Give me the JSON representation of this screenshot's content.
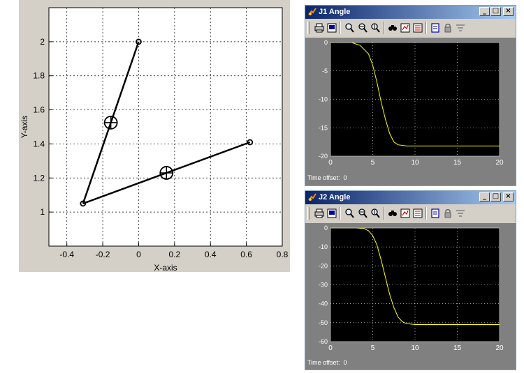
{
  "figure": {
    "xlabel": "X-axis",
    "ylabel": "Y-axis",
    "xticks": [
      "-0.4",
      "-0.2",
      "0",
      "0.2",
      "0.4",
      "0.6",
      "0.8"
    ],
    "yticks": [
      "1",
      "1.2",
      "1.4",
      "1.6",
      "1.8",
      "2"
    ],
    "grid": true,
    "links": [
      {
        "from": [
          0.0,
          2.0
        ],
        "to": [
          -0.31,
          1.05
        ],
        "com": [
          -0.155,
          1.525
        ]
      },
      {
        "from": [
          -0.31,
          1.05
        ],
        "to": [
          0.62,
          1.41
        ],
        "com": [
          0.155,
          1.23
        ]
      }
    ]
  },
  "scope1": {
    "title": "J1 Angle",
    "yticks": [
      "0",
      "-5",
      "-10",
      "-15",
      "-20"
    ],
    "xticks": [
      "0",
      "5",
      "10",
      "15",
      "20"
    ],
    "time_offset_label": "Time offset:",
    "time_offset_value": "0"
  },
  "scope2": {
    "title": "J2 Angle",
    "yticks": [
      "0",
      "-10",
      "-20",
      "-30",
      "-40",
      "-50",
      "-60"
    ],
    "xticks": [
      "0",
      "5",
      "10",
      "15",
      "20"
    ],
    "time_offset_label": "Time offset:",
    "time_offset_value": "0"
  },
  "window_buttons": {
    "minimize": "_",
    "maximize": "□",
    "close": "×"
  },
  "colors": {
    "titlebar_start": "#0a246a",
    "titlebar_end": "#a6caf0",
    "trace": "#ffff00",
    "scope_bg": "#000000"
  },
  "toolbar_icons": [
    "print-icon",
    "print-figure-icon",
    "zoom-icon",
    "zoom-x-icon",
    "zoom-y-icon",
    "autoscale-icon",
    "save-axes-icon",
    "restore-axes-icon",
    "parameters-icon",
    "lock-icon",
    "signal-selection-icon"
  ],
  "chart_data": [
    {
      "type": "line",
      "title": "J1 Angle",
      "xlim": [
        0,
        20
      ],
      "ylim": [
        -20,
        0
      ],
      "series": [
        {
          "x": [
            0,
            2.5,
            3.5,
            4.5,
            5.0,
            5.5,
            6.0,
            6.5,
            7.0,
            7.5,
            8.0,
            9.0,
            10,
            15,
            20
          ],
          "values": [
            0,
            0,
            -0.5,
            -2,
            -4,
            -7,
            -10.5,
            -13.5,
            -16,
            -17.5,
            -18,
            -18.2,
            -18.2,
            -18.2,
            -18.2
          ]
        }
      ]
    },
    {
      "type": "line",
      "title": "J2 Angle",
      "xlim": [
        0,
        20
      ],
      "ylim": [
        -60,
        0
      ],
      "series": [
        {
          "x": [
            0,
            3.0,
            4.0,
            4.5,
            5.0,
            5.5,
            6.0,
            6.5,
            7.0,
            7.5,
            8.0,
            8.5,
            9.0,
            10,
            15,
            20
          ],
          "values": [
            0,
            0,
            -0.3,
            -1.5,
            -4,
            -9,
            -17,
            -26,
            -35,
            -42,
            -47,
            -49.5,
            -50.5,
            -51,
            -51,
            -51
          ]
        }
      ]
    }
  ]
}
